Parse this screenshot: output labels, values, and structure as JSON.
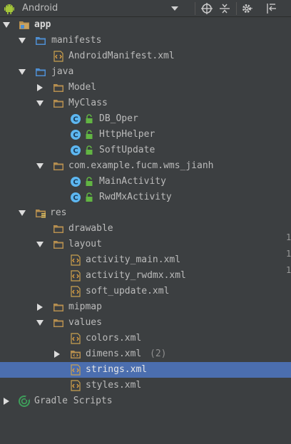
{
  "toolbar": {
    "view_title": "Android",
    "icons": [
      "android-icon",
      "chevron-down-icon",
      "target-icon",
      "collapse-icon",
      "gear-icon",
      "pin-icon"
    ]
  },
  "colors": {
    "background": "#3c3f41",
    "selection": "#4b6eaf",
    "folder_tan": "#b58e4f",
    "folder_blue": "#4e8ed1",
    "class_circle": "#5db7f1",
    "lock_green": "#62b543",
    "xml_orange": "#e0a040"
  },
  "tree": [
    {
      "label": "app",
      "bold": true
    },
    {
      "label": "manifests"
    },
    {
      "label": "AndroidManifest.xml"
    },
    {
      "label": "java"
    },
    {
      "label": "Model"
    },
    {
      "label": "MyClass"
    },
    {
      "label": "DB_Oper"
    },
    {
      "label": "HttpHelper"
    },
    {
      "label": "SoftUpdate"
    },
    {
      "label": "com.example.fucm.wms_jianh"
    },
    {
      "label": "MainActivity"
    },
    {
      "label": "RwdMxActivity"
    },
    {
      "label": "res"
    },
    {
      "label": "drawable"
    },
    {
      "label": "layout"
    },
    {
      "label": "activity_main.xml"
    },
    {
      "label": "activity_rwdmx.xml"
    },
    {
      "label": "soft_update.xml"
    },
    {
      "label": "mipmap"
    },
    {
      "label": "values"
    },
    {
      "label": "colors.xml"
    },
    {
      "label": "dimens.xml",
      "hint": "(2)"
    },
    {
      "label": "strings.xml",
      "selected": true
    },
    {
      "label": "styles.xml"
    },
    {
      "label": "Gradle Scripts"
    }
  ],
  "edge_marks": [
    "1",
    "1",
    "1"
  ]
}
